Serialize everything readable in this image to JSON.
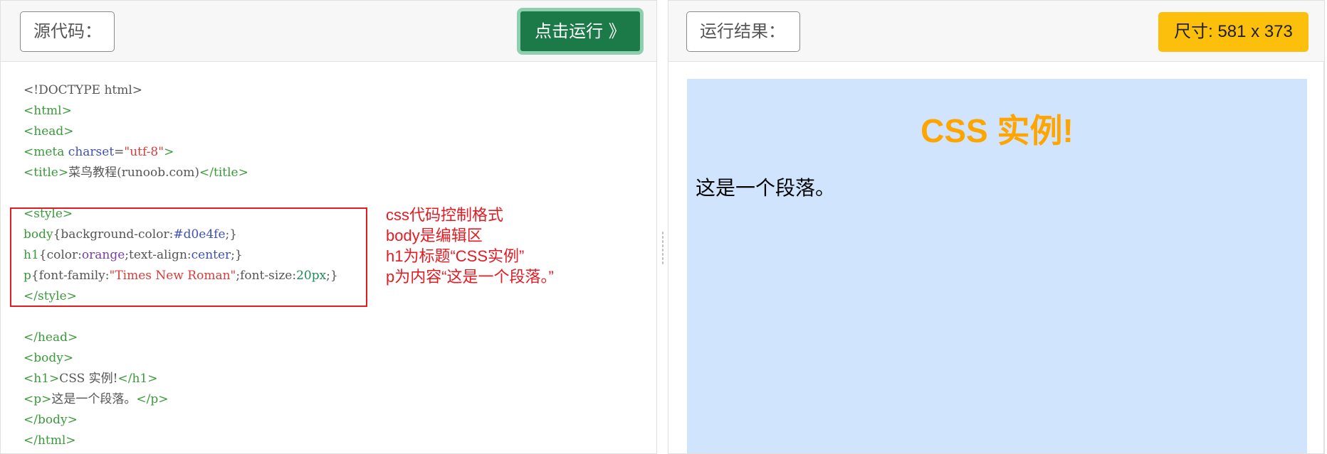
{
  "left_panel": {
    "source_label": "源代码：",
    "run_button": "点击运行 》"
  },
  "right_panel": {
    "result_label": "运行结果：",
    "size_badge": "尺寸: 581 x 373"
  },
  "code": {
    "doctype": "<!DOCTYPE html>",
    "html_open": "<html>",
    "head_open": "<head>",
    "meta_open": "<meta ",
    "meta_attr": "charset",
    "meta_eq": "=",
    "meta_val": "\"utf-8\"",
    "meta_close": ">",
    "title_open": "<title>",
    "title_text": "菜鸟教程(runoob.com)",
    "title_close": "</title>",
    "style_open": "<style>",
    "body_rule_sel": "body",
    "body_rule_open": "{background-color:",
    "body_rule_val": "#d0e4fe",
    "body_rule_close": ";}",
    "h1_rule_sel": "h1",
    "h1_rule_a": "{color:",
    "h1_rule_color": "orange",
    "h1_rule_b": ";text-align:",
    "h1_rule_align": "center",
    "h1_rule_close": ";}",
    "p_rule_sel": "p",
    "p_rule_a": "{font-family:",
    "p_rule_font": "\"Times New Roman\"",
    "p_rule_b": ";font-size:",
    "p_rule_size": "20px",
    "p_rule_close": ";}",
    "style_close": "</style>",
    "head_close": "</head>",
    "body_open": "<body>",
    "h1_open": "<h1>",
    "h1_text": "CSS 实例!",
    "h1_close": "</h1>",
    "p_open": "<p>",
    "p_text": "这是一个段落。",
    "p_close": "</p>",
    "body_close": "</body>",
    "html_close": "</html>"
  },
  "annotation": {
    "line1": "css代码控制格式",
    "line2": "body是编辑区",
    "line3": "h1为标题“CSS实例”",
    "line4": "p为内容“这是一个段落。”"
  },
  "preview": {
    "heading": "CSS 实例!",
    "paragraph": "这是一个段落。",
    "background": "#d0e4fe",
    "heading_color": "orange"
  },
  "colors": {
    "run_button": "#1b7a47",
    "size_badge": "#fbbf0c",
    "annotation": "#e31b23"
  }
}
